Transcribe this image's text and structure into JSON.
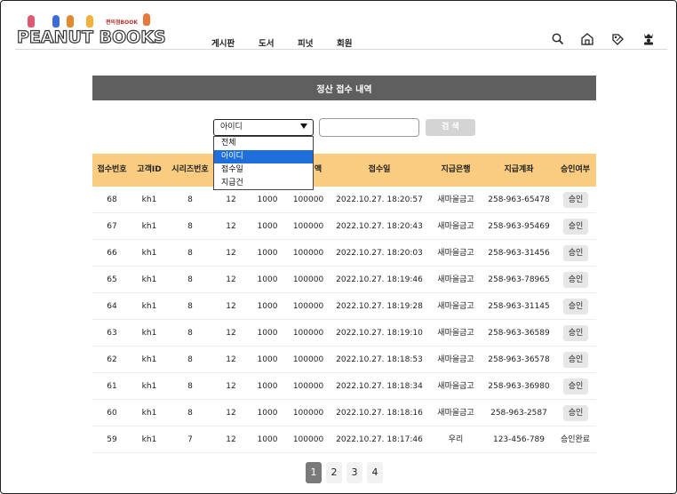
{
  "brand": {
    "logo_text": "PEANUT BOOKS",
    "logo_sub": "편의점BOOK"
  },
  "nav": {
    "items": [
      "게시판",
      "도서",
      "피넛",
      "회원"
    ]
  },
  "header_icons": [
    "search-icon",
    "home-icon",
    "tag-icon",
    "king-icon"
  ],
  "page": {
    "title": "정산 접수 내역"
  },
  "search": {
    "select_value": "아이디",
    "options": [
      "전체",
      "아이디",
      "접수일",
      "지급건"
    ],
    "selected_index": 1,
    "input_value": "",
    "button_label": "검 색"
  },
  "table": {
    "columns": [
      "접수번호",
      "고객ID",
      "시리즈번호",
      "",
      "",
      "액",
      "접수일",
      "지급은행",
      "지급계좌",
      "승인여부"
    ],
    "rows": [
      {
        "no": "68",
        "id": "kh1",
        "series": "8",
        "c4": "12",
        "c5": "1000",
        "amount": "100000",
        "date": "2022.10.27. 18:20:57",
        "bank": "새마을금고",
        "account": "258-963-65478",
        "status": "승인",
        "status_is_button": true
      },
      {
        "no": "67",
        "id": "kh1",
        "series": "8",
        "c4": "12",
        "c5": "1000",
        "amount": "100000",
        "date": "2022.10.27. 18:20:43",
        "bank": "새마을금고",
        "account": "258-963-95469",
        "status": "승인",
        "status_is_button": true
      },
      {
        "no": "66",
        "id": "kh1",
        "series": "8",
        "c4": "12",
        "c5": "1000",
        "amount": "100000",
        "date": "2022.10.27. 18:20:03",
        "bank": "새마을금고",
        "account": "258-963-31456",
        "status": "승인",
        "status_is_button": true
      },
      {
        "no": "65",
        "id": "kh1",
        "series": "8",
        "c4": "12",
        "c5": "1000",
        "amount": "100000",
        "date": "2022.10.27. 18:19:46",
        "bank": "새마을금고",
        "account": "258-963-78965",
        "status": "승인",
        "status_is_button": true
      },
      {
        "no": "64",
        "id": "kh1",
        "series": "8",
        "c4": "12",
        "c5": "1000",
        "amount": "100000",
        "date": "2022.10.27. 18:19:28",
        "bank": "새마을금고",
        "account": "258-963-31145",
        "status": "승인",
        "status_is_button": true
      },
      {
        "no": "63",
        "id": "kh1",
        "series": "8",
        "c4": "12",
        "c5": "1000",
        "amount": "100000",
        "date": "2022.10.27. 18:19:10",
        "bank": "새마을금고",
        "account": "258-963-36589",
        "status": "승인",
        "status_is_button": true
      },
      {
        "no": "62",
        "id": "kh1",
        "series": "8",
        "c4": "12",
        "c5": "1000",
        "amount": "100000",
        "date": "2022.10.27. 18:18:53",
        "bank": "새마을금고",
        "account": "258-963-36578",
        "status": "승인",
        "status_is_button": true
      },
      {
        "no": "61",
        "id": "kh1",
        "series": "8",
        "c4": "12",
        "c5": "1000",
        "amount": "100000",
        "date": "2022.10.27. 18:18:34",
        "bank": "새마을금고",
        "account": "258-963-36980",
        "status": "승인",
        "status_is_button": true
      },
      {
        "no": "60",
        "id": "kh1",
        "series": "8",
        "c4": "12",
        "c5": "1000",
        "amount": "100000",
        "date": "2022.10.27. 18:18:16",
        "bank": "새마을금고",
        "account": "258-963-2587",
        "status": "승인",
        "status_is_button": true
      },
      {
        "no": "59",
        "id": "kh1",
        "series": "7",
        "c4": "12",
        "c5": "1000",
        "amount": "100000",
        "date": "2022.10.27. 18:17:46",
        "bank": "우리",
        "account": "123-456-789",
        "status": "승인완료",
        "status_is_button": false
      }
    ]
  },
  "pagination": {
    "pages": [
      "1",
      "2",
      "3",
      "4"
    ],
    "current": "1"
  },
  "colors": {
    "title_bar": "#5f5f5f",
    "table_header": "#f9cc80",
    "dropdown_selected": "#1e6fdc",
    "search_button": "#d4d4d4",
    "active_page": "#7a7a7a"
  }
}
